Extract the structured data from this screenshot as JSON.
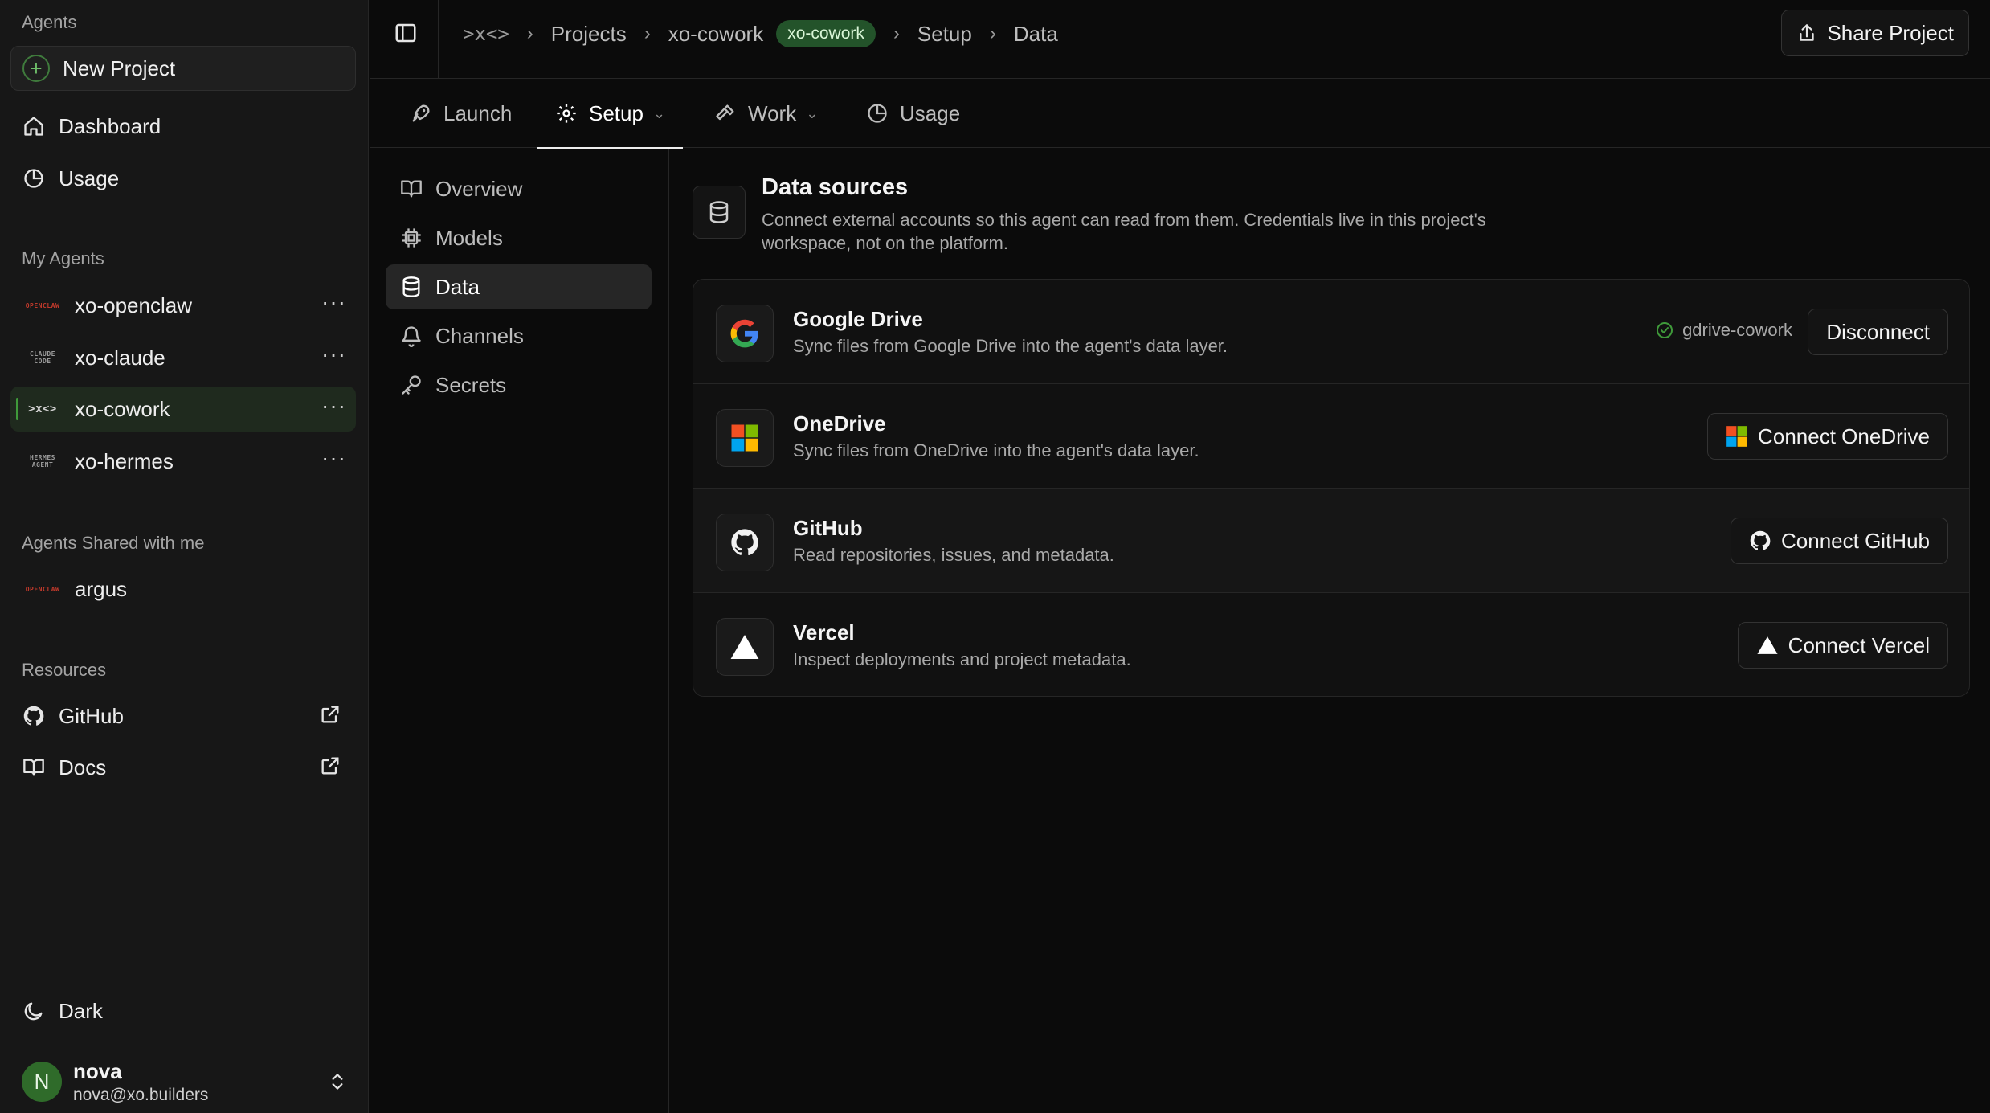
{
  "sidebar": {
    "agents_heading": "Agents",
    "new_project_label": "New Project",
    "nav": [
      {
        "label": "Dashboard",
        "icon": "home-icon"
      },
      {
        "label": "Usage",
        "icon": "pie-chart-icon"
      }
    ],
    "my_agents_heading": "My Agents",
    "my_agents": [
      {
        "name": "xo-openclaw",
        "logo_text": "OPENCLAW",
        "logo_icon": "openclaw-logo"
      },
      {
        "name": "xo-claude",
        "logo_text": "CLAUDE CODE",
        "logo_icon": "claude-code-logo"
      },
      {
        "name": "xo-cowork",
        "logo_text": ">x<>",
        "logo_icon": "xo-logo",
        "active": true
      },
      {
        "name": "xo-hermes",
        "logo_text": "HERMES AGENT",
        "logo_icon": "hermes-logo"
      }
    ],
    "shared_heading": "Agents Shared with me",
    "shared_agents": [
      {
        "name": "argus",
        "logo_text": "OPENCLAW",
        "logo_icon": "openclaw-logo"
      }
    ],
    "resources_heading": "Resources",
    "resources": [
      {
        "label": "GitHub",
        "icon": "github-icon"
      },
      {
        "label": "Docs",
        "icon": "book-icon"
      }
    ],
    "theme_label": "Dark",
    "user": {
      "initial": "N",
      "name": "nova",
      "email": "nova@xo.builders"
    }
  },
  "topbar": {
    "breadcrumb": [
      "Projects",
      "xo-cowork",
      "Setup",
      "Data"
    ],
    "project_badge": "xo-cowork",
    "share_label": "Share Project"
  },
  "tabs": [
    {
      "label": "Launch",
      "icon": "rocket-icon"
    },
    {
      "label": "Setup",
      "icon": "gear-icon",
      "active": true,
      "dropdown": true
    },
    {
      "label": "Work",
      "icon": "hammer-icon",
      "dropdown": true
    },
    {
      "label": "Usage",
      "icon": "pie-chart-icon"
    }
  ],
  "subnav": [
    {
      "label": "Overview",
      "icon": "book-icon"
    },
    {
      "label": "Models",
      "icon": "cpu-icon"
    },
    {
      "label": "Data",
      "icon": "database-icon",
      "active": true
    },
    {
      "label": "Channels",
      "icon": "bell-icon"
    },
    {
      "label": "Secrets",
      "icon": "key-icon"
    }
  ],
  "data_sources": {
    "title": "Data sources",
    "description": "Connect external accounts so this agent can read from them. Credentials live in this project's workspace, not on the platform.",
    "items": [
      {
        "name": "Google Drive",
        "desc": "Sync files from Google Drive into the agent's data layer.",
        "icon": "google-drive-icon",
        "connected_account": "gdrive-cowork",
        "button": "Disconnect"
      },
      {
        "name": "OneDrive",
        "desc": "Sync files from OneDrive into the agent's data layer.",
        "icon": "microsoft-icon",
        "button": "Connect OneDrive"
      },
      {
        "name": "GitHub",
        "desc": "Read repositories, issues, and metadata.",
        "icon": "github-icon",
        "button": "Connect GitHub"
      },
      {
        "name": "Vercel",
        "desc": "Inspect deployments and project metadata.",
        "icon": "vercel-icon",
        "button": "Connect Vercel"
      }
    ]
  },
  "colors": {
    "accent_green": "#23532a",
    "connected_green": "#3f9a3a",
    "background": "#0b0b0b",
    "sidebar": "#171717"
  }
}
